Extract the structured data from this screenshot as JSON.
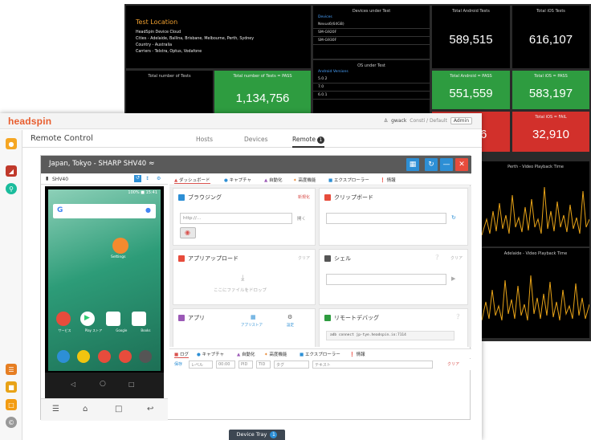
{
  "dashboard": {
    "location_title": "Test Location",
    "location_lines": [
      "HeadSpin Device Cloud",
      "Cities - Adelaide, Ballina, Brisbane, Melbourne, Perth, Sydney",
      "Country - Australia",
      "Carriers - Telstra, Optus, Vodafone"
    ],
    "devices_header": "Devices under Test",
    "devices_sub": "Devices",
    "devices": [
      "Nexus6(64GB)",
      "SM-G920F",
      "SM-G930F"
    ],
    "os_header": "OS under Test",
    "os_sub": "Android Versions",
    "os_versions": [
      "5.0.2",
      "7.0",
      "6.0.1"
    ],
    "total_tests_label": "Total number of Tests",
    "total_pass_label": "Total number of Tests = PASS",
    "total_pass_value": "1,134,756",
    "android_tests_label": "Total Android Tests",
    "android_tests_value": "589,515",
    "ios_tests_label": "Total iOS Tests",
    "ios_tests_value": "616,107",
    "android_pass_label": "Total Android = PASS",
    "android_pass_value": "551,559",
    "ios_pass_label": "Total iOS = PASS",
    "ios_pass_value": "583,197",
    "android_fail_value": "6",
    "ios_fail_label": "Total iOS = FAIL",
    "ios_fail_value": "32,910",
    "perth_chart_title": "Perth - Video Playback Time",
    "adelaide_chart_title": "Adelaide - Video Playback Time",
    "colors": {
      "pass": "#2e9c40",
      "fail": "#d2302b",
      "line": "#e8a317"
    }
  },
  "app": {
    "logo": "headspin",
    "user": "gwack",
    "user_detail": "Consti / Default",
    "admin_label": "Admin",
    "title": "Remote Control",
    "nav": {
      "hosts": "Hosts",
      "devices": "Devices",
      "remote": "Remote",
      "remote_count": "1"
    },
    "device_title": "Japan, Tokyo - SHARP SHV40",
    "device_name": "SHV40",
    "status_time": "100% ■ 15:41",
    "tool_tabs": [
      "ダッシュボード",
      "キャプチャ",
      "自動化",
      "高度機能",
      "エクスプローラー",
      "情報"
    ],
    "cards": {
      "browse": {
        "title": "ブラウジング",
        "action": "新規化",
        "placeholder": "http://...",
        "go": "開く"
      },
      "clipboard": {
        "title": "クリップボード"
      },
      "upload": {
        "title": "アプリアップロード",
        "action": "クリア",
        "hint": "ここにファイルをドロップ"
      },
      "shell": {
        "title": "シェル",
        "action": "クリア"
      },
      "apps": {
        "title": "アプリ",
        "store": "アプリストア",
        "settings": "設定"
      },
      "debug": {
        "title": "リモートデバッグ",
        "cmd": "adb connect jp-tye.headspin.io:7114"
      }
    },
    "log_tabs": [
      "ログ",
      "キャプチャ",
      "自動化",
      "高度機能",
      "エクスプローラー",
      "情報"
    ],
    "log_filters": {
      "save": "保存",
      "level": "レベル",
      "pid_label": "PID",
      "tid_label": "TID",
      "tag": "タグ",
      "text": "テキスト",
      "clear": "クリア",
      "count_ph": "00:00"
    },
    "phone_apps": {
      "settings_label": "Settings",
      "row1": [
        "サービス",
        "Play ストア",
        "Google",
        "Books"
      ]
    },
    "device_tray": "Device Tray",
    "tray_count": "1"
  }
}
